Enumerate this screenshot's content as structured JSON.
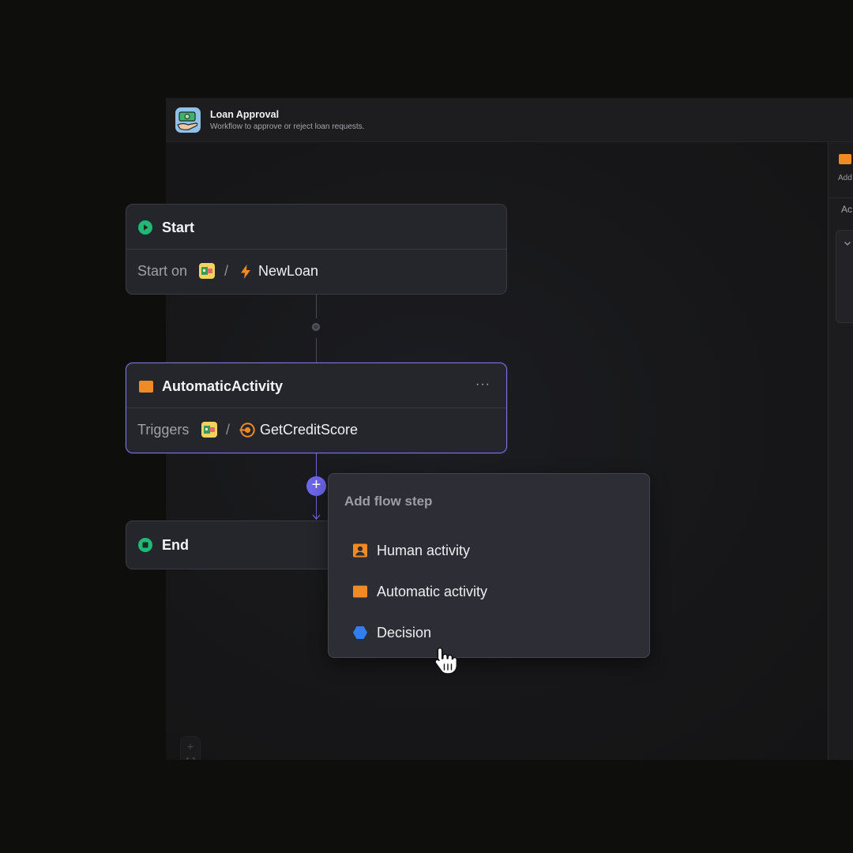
{
  "app": {
    "title": "Loan Approval",
    "subtitle": "Workflow to approve or reject loan requests."
  },
  "side_panel": {
    "text_a": "Add",
    "text_b": "Ac"
  },
  "nodes": {
    "start": {
      "title": "Start",
      "body_label": "Start on",
      "separator": "/",
      "value": "NewLoan",
      "value_icon": "lightning-icon"
    },
    "automatic": {
      "title": "AutomaticActivity",
      "body_label": "Triggers",
      "separator": "/",
      "value": "GetCreditScore",
      "value_icon": "service-icon",
      "more": "···"
    },
    "end": {
      "title": "End"
    }
  },
  "popup": {
    "title": "Add flow step",
    "items": [
      {
        "label": "Human activity",
        "icon": "human-activity-icon"
      },
      {
        "label": "Automatic activity",
        "icon": "automatic-activity-icon"
      },
      {
        "label": "Decision",
        "icon": "decision-icon"
      }
    ]
  },
  "zoom": {
    "in": "+",
    "out": "−"
  },
  "colors": {
    "accent": "#6e66ea",
    "start_green": "#1fb874",
    "activity_orange": "#ef8a25",
    "decision_blue": "#2f7ff0"
  }
}
